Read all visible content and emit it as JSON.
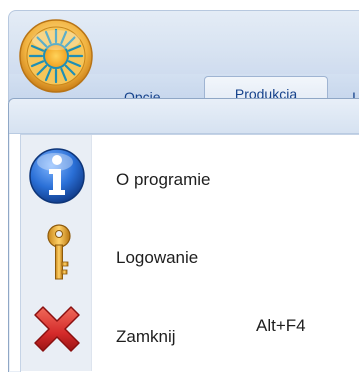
{
  "ribbon": {
    "tabs": [
      {
        "label": "Opcje"
      },
      {
        "label": "Produkcja"
      },
      {
        "label": "I"
      }
    ]
  },
  "app_menu": {
    "items": [
      {
        "label": "O programie",
        "icon": "info-icon",
        "shortcut": ""
      },
      {
        "label": "Logowanie",
        "icon": "key-icon",
        "shortcut": ""
      },
      {
        "label": "Zamknij",
        "icon": "close-x-icon",
        "shortcut": "Alt+F4"
      }
    ]
  },
  "colors": {
    "tab_text": "#15428b",
    "menu_text": "#1e1e1e",
    "info_blue": "#1f5fbf",
    "key_gold": "#e3a323",
    "close_red": "#d42a2a"
  }
}
